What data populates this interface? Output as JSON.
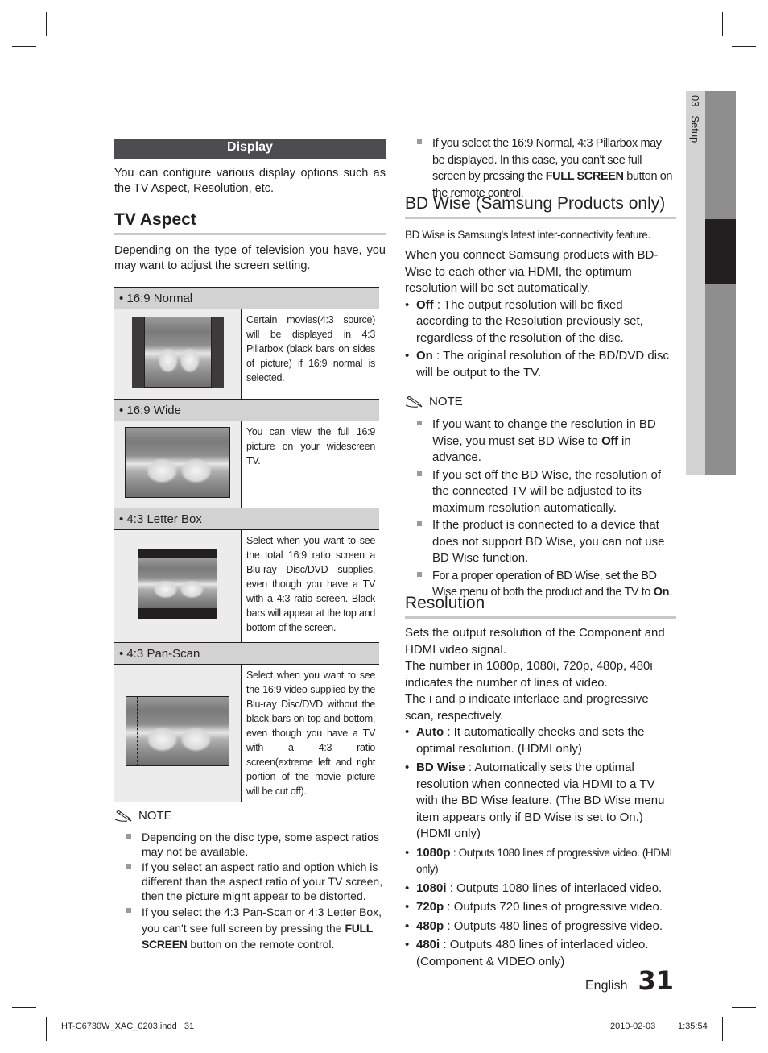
{
  "side_tab": {
    "number": "03",
    "label": "Setup"
  },
  "display": {
    "title": "Display",
    "intro": "You can configure various display options such as the TV Aspect, Resolution, etc."
  },
  "tv_aspect": {
    "heading": "TV Aspect",
    "intro": "Depending on the type of television you have, you may want to adjust the screen setting.",
    "options": [
      {
        "label": "• 16:9 Normal",
        "picture": "pillarbox-image",
        "description": "Certain movies(4:3 source) will be displayed in 4:3 Pillarbox (black bars on sides of picture) if 16:9 normal is selected."
      },
      {
        "label": "• 16:9 Wide",
        "picture": "widescreen-image",
        "description": "You can view the full 16:9 picture on your widescreen TV."
      },
      {
        "label": "• 4:3 Letter Box",
        "picture": "letterbox-image",
        "description": "Select when you want to see the total 16:9 ratio screen a Blu-ray Disc/DVD supplies, even though you have a TV with a 4:3 ratio screen. Black bars will appear at the top and bottom of the screen."
      },
      {
        "label": "• 4:3 Pan-Scan",
        "picture": "panscan-image",
        "description": "Select when you want to see the 16:9 video supplied by the Blu-ray Disc/DVD without the black bars on top and bottom, even though you have a TV with a 4:3 ratio screen(extreme left and right portion of the movie picture will be cut off)."
      }
    ],
    "note": {
      "title": "NOTE",
      "items": [
        "Depending on the disc type, some aspect ratios may not be available.",
        "If you select an aspect ratio and option which is different than the aspect ratio of your TV screen, then the picture might appear to be distorted.",
        {
          "pre": "If you select the 4:3 Pan-Scan or 4:3 Letter Box, you can't see full screen by pressing the ",
          "bold": "FULL SCREEN",
          "post": " button on the remote control."
        }
      ]
    }
  },
  "right_note_top": {
    "pre": "If you select the 16:9 Normal, 4:3 Pillarbox may be displayed. In this case, you can't see full screen by pressing the ",
    "bold": "FULL SCREEN",
    "post": " button on the remote control."
  },
  "bd_wise": {
    "heading": "BD Wise (Samsung Products only)",
    "subtitle": "BD Wise is Samsung's latest inter-connectivity feature.",
    "intro": "When you connect Samsung products with BD-Wise to each other via HDMI, the optimum resolution will be set automatically.",
    "options": [
      {
        "term": "Off",
        "text": " : The output resolution will be fixed according to the Resolution previously set, regardless of the resolution of the disc."
      },
      {
        "term": "On",
        "text": " : The original resolution of the BD/DVD disc will be output to the TV."
      }
    ],
    "note": {
      "title": "NOTE",
      "items": [
        {
          "pre": "If you want to change the resolution in BD Wise, you must set BD Wise to ",
          "bold": "Off",
          "post": " in advance."
        },
        {
          "pre": "If you set off the BD Wise, the resolution of the connected TV will be adjusted to its maximum resolution automatically.",
          "bold": "",
          "post": ""
        },
        {
          "pre": "If the product is connected to a device that does not support BD Wise, you can not use BD Wise function.",
          "bold": "",
          "post": ""
        },
        {
          "pre": "For a proper operation of BD Wise, set the BD Wise menu of both the product and the TV to ",
          "bold": "On",
          "post": "."
        }
      ]
    }
  },
  "resolution": {
    "heading": "Resolution",
    "paragraphs": [
      "Sets the output resolution of the Component and HDMI video signal.",
      "The number in 1080p, 1080i, 720p, 480p, 480i indicates the number of lines of video.",
      "The i and p indicate interlace and progressive scan, respectively."
    ],
    "options": [
      {
        "term": "Auto",
        "text": " : It automatically checks and sets the optimal resolution. (HDMI only)"
      },
      {
        "term": "BD Wise",
        "text": " : Automatically sets the optimal resolution when connected via HDMI to a TV with the BD Wise feature. (The BD Wise menu item appears only if BD Wise is set to On.) (HDMI only)"
      },
      {
        "term": "1080p",
        "text": " : Outputs 1080 lines of progressive video. (HDMI only)"
      },
      {
        "term": "1080i",
        "text": " : Outputs 1080 lines of interlaced video."
      },
      {
        "term": "720p",
        "text": " : Outputs 720 lines of progressive video."
      },
      {
        "term": "480p",
        "text": " : Outputs 480 lines of progressive video."
      },
      {
        "term": "480i",
        "text": " : Outputs 480 lines of interlaced video. (Component & VIDEO only)"
      }
    ]
  },
  "page_footer": {
    "language": "English",
    "page_number": "31"
  },
  "print_slug": {
    "file": "HT-C6730W_XAC_0203.indd   31",
    "date": "2010-02-03",
    "time": "1:35:54"
  }
}
